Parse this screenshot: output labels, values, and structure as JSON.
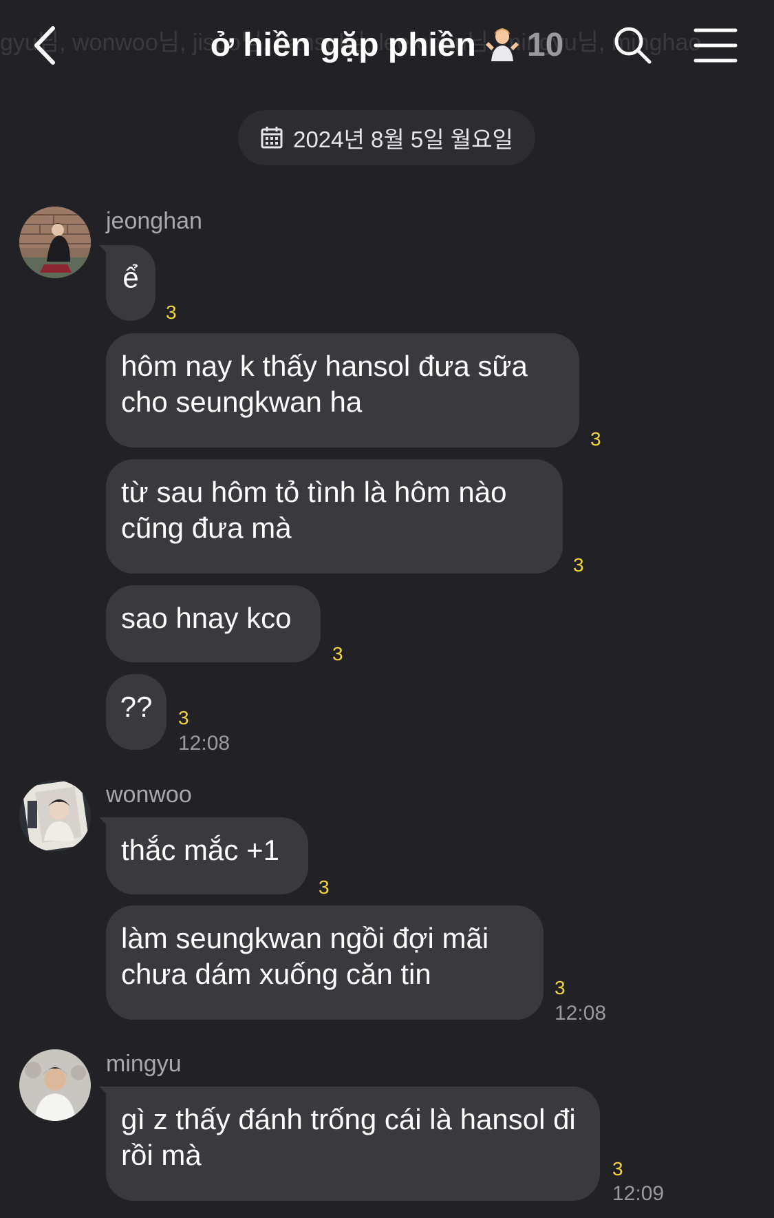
{
  "header": {
    "ghost_text": "gyu님, wonwoo님, jisoo님, hansol님, lee chan님, mingyu님, minghao",
    "title": "ở hiền gặp phiền",
    "emoji": "shrug-person-emoji",
    "member_count": "10",
    "icons": [
      "back-arrow-icon",
      "search-icon",
      "hamburger-menu-icon"
    ]
  },
  "date_divider": {
    "label": "2024년 8월 5일 월요일",
    "icon": "calendar-icon"
  },
  "colors": {
    "background": "#222226",
    "bubble": "#3a3a3e",
    "unread": "#f2d43c",
    "meta": "#9a9a9e"
  },
  "groups": [
    {
      "sender": "jeonghan",
      "messages": [
        {
          "text": "ể",
          "unread": "3"
        },
        {
          "text": "hôm nay k thấy hansol đưa sữa cho seungkwan ha",
          "unread": "3"
        },
        {
          "text": "từ sau hôm tỏ tình là hôm nào cũng đưa mà",
          "unread": "3"
        },
        {
          "text": "sao hnay kco",
          "unread": "3"
        },
        {
          "text": "??",
          "unread": "3",
          "time": "12:08"
        }
      ]
    },
    {
      "sender": "wonwoo",
      "messages": [
        {
          "text": "thắc mắc +1",
          "unread": "3"
        },
        {
          "text": "làm seungkwan ngồi đợi mãi chưa dám xuống căn tin",
          "unread": "3",
          "time": "12:08"
        }
      ]
    },
    {
      "sender": "mingyu",
      "messages": [
        {
          "text": "gì z thấy đánh trống cái là hansol đi rồi mà",
          "unread": "3",
          "time": "12:09"
        }
      ]
    }
  ]
}
